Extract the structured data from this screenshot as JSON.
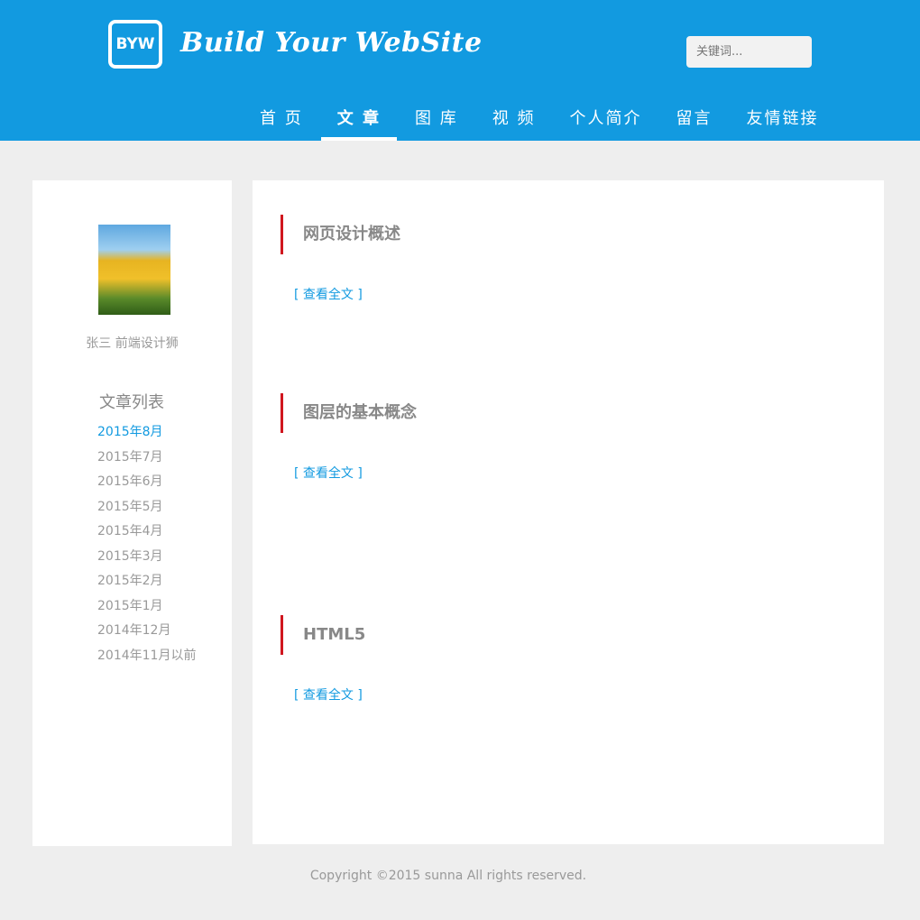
{
  "header": {
    "logo_text": "BYW",
    "site_title": "Build Your WebSite",
    "search_placeholder": "关键词...",
    "nav": [
      {
        "label": "首 页"
      },
      {
        "label": "文 章"
      },
      {
        "label": "图 库"
      },
      {
        "label": "视 频"
      },
      {
        "label": "个人简介"
      },
      {
        "label": "留言"
      },
      {
        "label": "友情链接"
      }
    ],
    "active_nav_index": 1
  },
  "sidebar": {
    "author": "张三  前端设计狮",
    "list_title": "文章列表",
    "archive": [
      {
        "label": "2015年8月"
      },
      {
        "label": "2015年7月"
      },
      {
        "label": "2015年6月"
      },
      {
        "label": "2015年5月"
      },
      {
        "label": "2015年4月"
      },
      {
        "label": "2015年3月"
      },
      {
        "label": "2015年2月"
      },
      {
        "label": "2015年1月"
      },
      {
        "label": "2014年12月"
      },
      {
        "label": "2014年11月以前"
      }
    ]
  },
  "articles": [
    {
      "title": "网页设计概述",
      "body": "",
      "read_more": "[ 查看全文 ]"
    },
    {
      "title": "图层的基本概念",
      "body": "",
      "read_more": "[ 查看全文 ]"
    },
    {
      "title": "HTML5",
      "body": "",
      "read_more": "[ 查看全文 ]"
    }
  ],
  "footer": {
    "copyright": "Copyright ©2015 sunna All rights reserved."
  },
  "colors": {
    "brand": "#129ae0",
    "accent": "#d0161f",
    "background": "#eeeeee"
  }
}
